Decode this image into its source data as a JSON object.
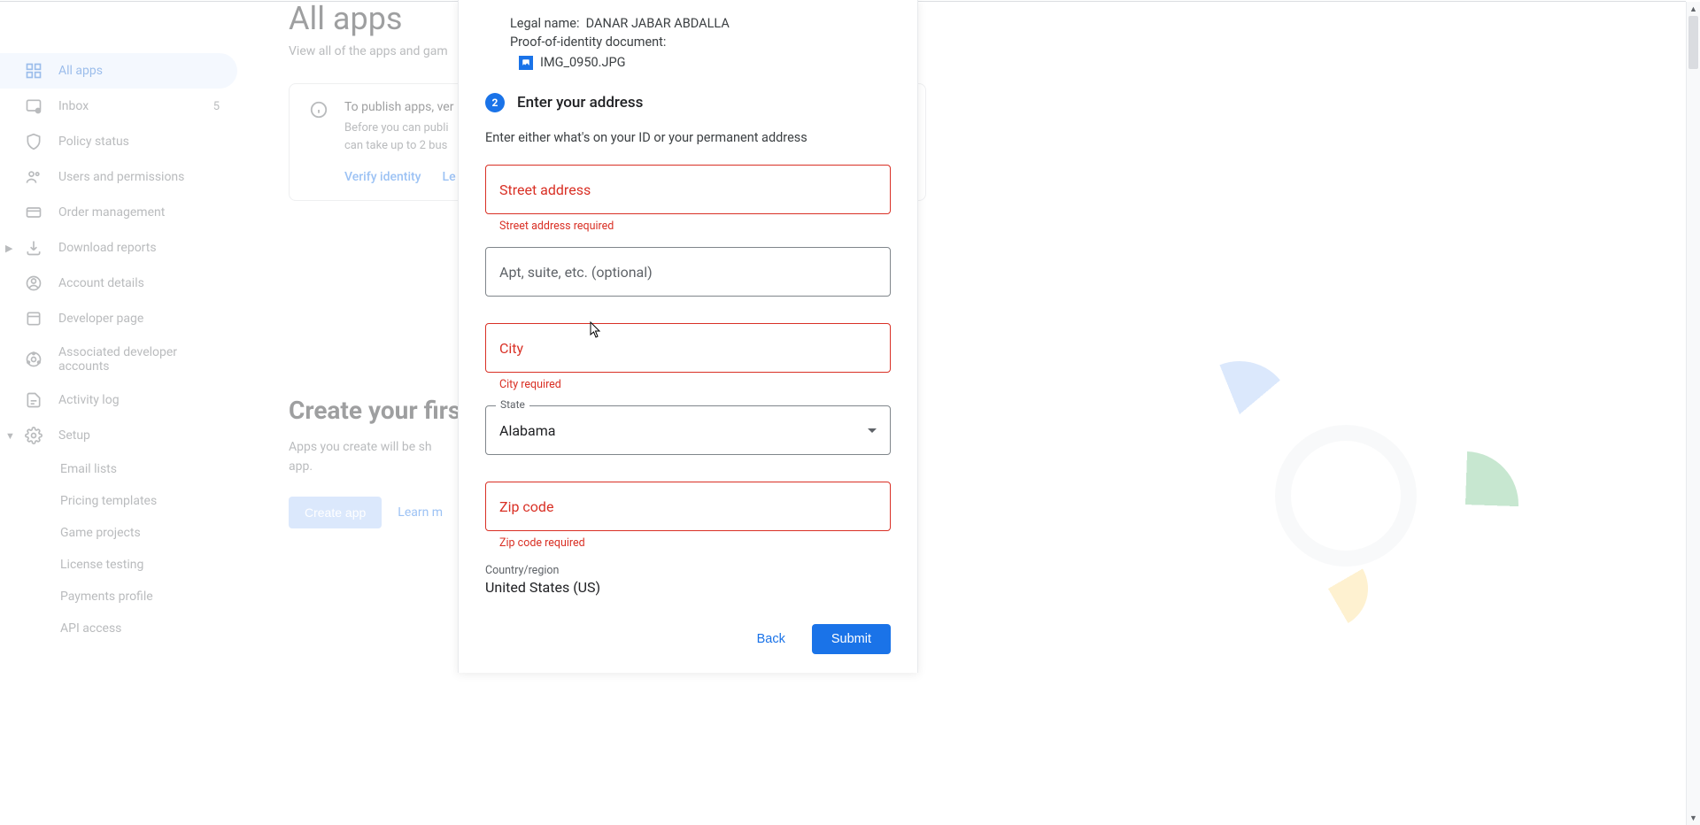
{
  "page": {
    "title": "All apps",
    "subtitle": "View all of the apps and gam"
  },
  "sidebar": {
    "items": [
      {
        "label": "All apps",
        "icon": "apps-icon",
        "active": true
      },
      {
        "label": "Inbox",
        "icon": "inbox-icon",
        "badge": "5"
      },
      {
        "label": "Policy status",
        "icon": "shield-icon"
      },
      {
        "label": "Users and permissions",
        "icon": "users-icon"
      },
      {
        "label": "Order management",
        "icon": "card-icon"
      },
      {
        "label": "Download reports",
        "icon": "download-icon",
        "expandable": true
      },
      {
        "label": "Account details",
        "icon": "account-icon"
      },
      {
        "label": "Developer page",
        "icon": "page-icon"
      },
      {
        "label": "Associated developer accounts",
        "icon": "link-icon"
      },
      {
        "label": "Activity log",
        "icon": "doc-icon"
      },
      {
        "label": "Setup",
        "icon": "gear-icon",
        "expandable": true
      }
    ],
    "subitems": [
      {
        "label": "Email lists"
      },
      {
        "label": "Pricing templates"
      },
      {
        "label": "Game projects"
      },
      {
        "label": "License testing"
      },
      {
        "label": "Payments profile"
      },
      {
        "label": "API access"
      }
    ]
  },
  "alert": {
    "title": "To publish apps, ver",
    "text_line1": "Before you can publi",
    "text_line2": "can take up to 2 bus",
    "verify_label": "Verify identity",
    "learn_label": "Le"
  },
  "create": {
    "title": "Create your first",
    "text_line1": "Apps you create will be sh",
    "text_line2": "app.",
    "button_label": "Create app",
    "learn_label": "Learn m"
  },
  "modal": {
    "legal_name_label": "Legal name:",
    "legal_name_value": "DANAR JABAR ABDALLA",
    "proof_label": "Proof-of-identity document:",
    "file_name": "IMG_0950.JPG",
    "step_number": "2",
    "step_title": "Enter your address",
    "step_desc": "Enter either what's on your ID or your permanent address",
    "street": {
      "label": "Street address",
      "error": "Street address required"
    },
    "apt": {
      "label": "Apt, suite, etc. (optional)"
    },
    "city": {
      "label": "City",
      "error": "City required"
    },
    "state": {
      "label": "State",
      "value": "Alabama"
    },
    "zip": {
      "label": "Zip code",
      "error": "Zip code required"
    },
    "country": {
      "label": "Country/region",
      "value": "United States (US)"
    },
    "back_label": "Back",
    "submit_label": "Submit"
  }
}
